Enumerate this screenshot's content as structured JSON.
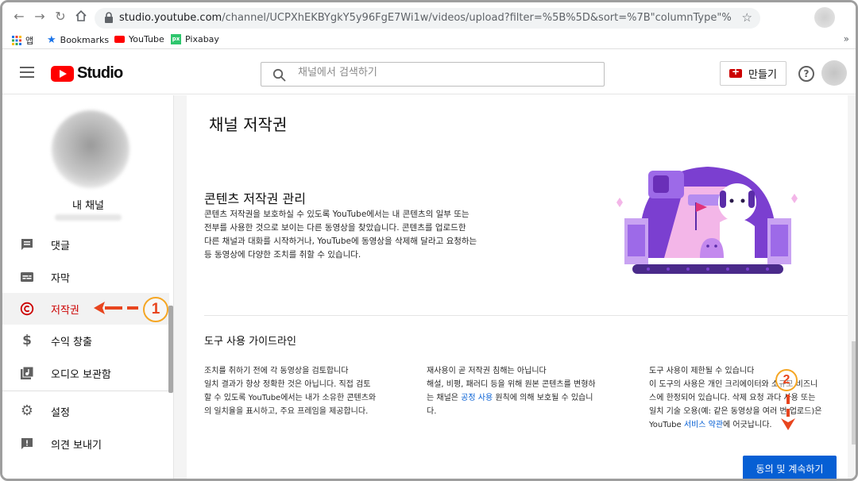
{
  "browser": {
    "url_domain": "studio.youtube.com",
    "url_path": "/channel/UCPXhEKBYgkY5y96FgE7Wi1w/videos/upload?filter=%5B%5D&sort=%7B\"columnType\"%3A\"date\"%2C\"sortOrder...",
    "bookmarks": [
      {
        "label": "앱",
        "icon": "apps-grid-icon"
      },
      {
        "label": "Bookmarks",
        "icon": "star-icon"
      },
      {
        "label": "YouTube",
        "icon": "youtube-icon"
      },
      {
        "label": "Pixabay",
        "icon": "pixabay-icon"
      }
    ],
    "more": "»"
  },
  "header": {
    "logo_text": "Studio",
    "search_placeholder": "채널에서 검색하기",
    "create_label": "만들기",
    "help_glyph": "?"
  },
  "sidebar": {
    "channel_name": "내 채널",
    "items": [
      {
        "label": "댓글",
        "icon": "comment-icon"
      },
      {
        "label": "자막",
        "icon": "subtitles-icon"
      },
      {
        "label": "저작권",
        "icon": "copyright-icon",
        "active": true
      },
      {
        "label": "수익 창출",
        "icon": "dollar-icon"
      },
      {
        "label": "오디오 보관함",
        "icon": "audio-library-icon"
      },
      {
        "label": "설정",
        "icon": "gear-icon"
      },
      {
        "label": "의견 보내기",
        "icon": "feedback-icon"
      }
    ]
  },
  "annotations": {
    "step1": "1",
    "step2": "2"
  },
  "main": {
    "page_title": "채널 저작권",
    "section_title": "콘텐츠 저작권 관리",
    "section_lines": [
      "콘텐츠 저작권을 보호하실 수 있도록 YouTube에서는 내 콘텐츠의 일부 또는",
      "전부를 사용한 것으로 보이는 다른 동영상을 찾았습니다. 콘텐츠를 업로드한",
      "다른 채널과 대화를 시작하거나, YouTube에 동영상을 삭제해 달라고 요청하는",
      "등 동영상에 다양한 조치를 취할 수 있습니다."
    ],
    "guide_title": "도구 사용 가이드라인",
    "col1": {
      "head": "조치를 취하기 전에 각 동영상을 검토합니다",
      "lines": [
        "일치 결과가 항상 정확한 것은 아닙니다. 직접 검토",
        "할 수 있도록 YouTube에서는 내가 소유한 콘텐츠와",
        "의 일치율을 표시하고, 주요 프레임을 제공합니다."
      ]
    },
    "col2": {
      "head": "재사용이 곧 저작권 침해는 아닙니다",
      "line1": "해설, 비평, 패러디 등을 위해 원본 콘텐츠를 변형하",
      "line2_pre": "는 채널은 ",
      "line2_link": "공정 사용",
      "line2_post": " 원칙에 의해 보호될 수 있습니",
      "line3": "다."
    },
    "col3": {
      "head": "도구 사용이 제한될 수 있습니다",
      "lines": [
        "이 도구의 사용은 개인 크리에이터와 소규모 비즈니",
        "스에 한정되어 있습니다. 삭제 요청 과다 사용 또는",
        "일치 기술 오용(예: 같은 동영상을 여러 번 업로드)은"
      ],
      "last_pre": "YouTube ",
      "last_link": "서비스 약관",
      "last_post": "에 어긋납니다."
    },
    "agree_label": "동의 및 계속하기"
  },
  "colors": {
    "accent_red": "#cc0000",
    "link_blue": "#065fd4",
    "annotation_red": "#e8451e",
    "annotation_orange": "#f5a623"
  }
}
